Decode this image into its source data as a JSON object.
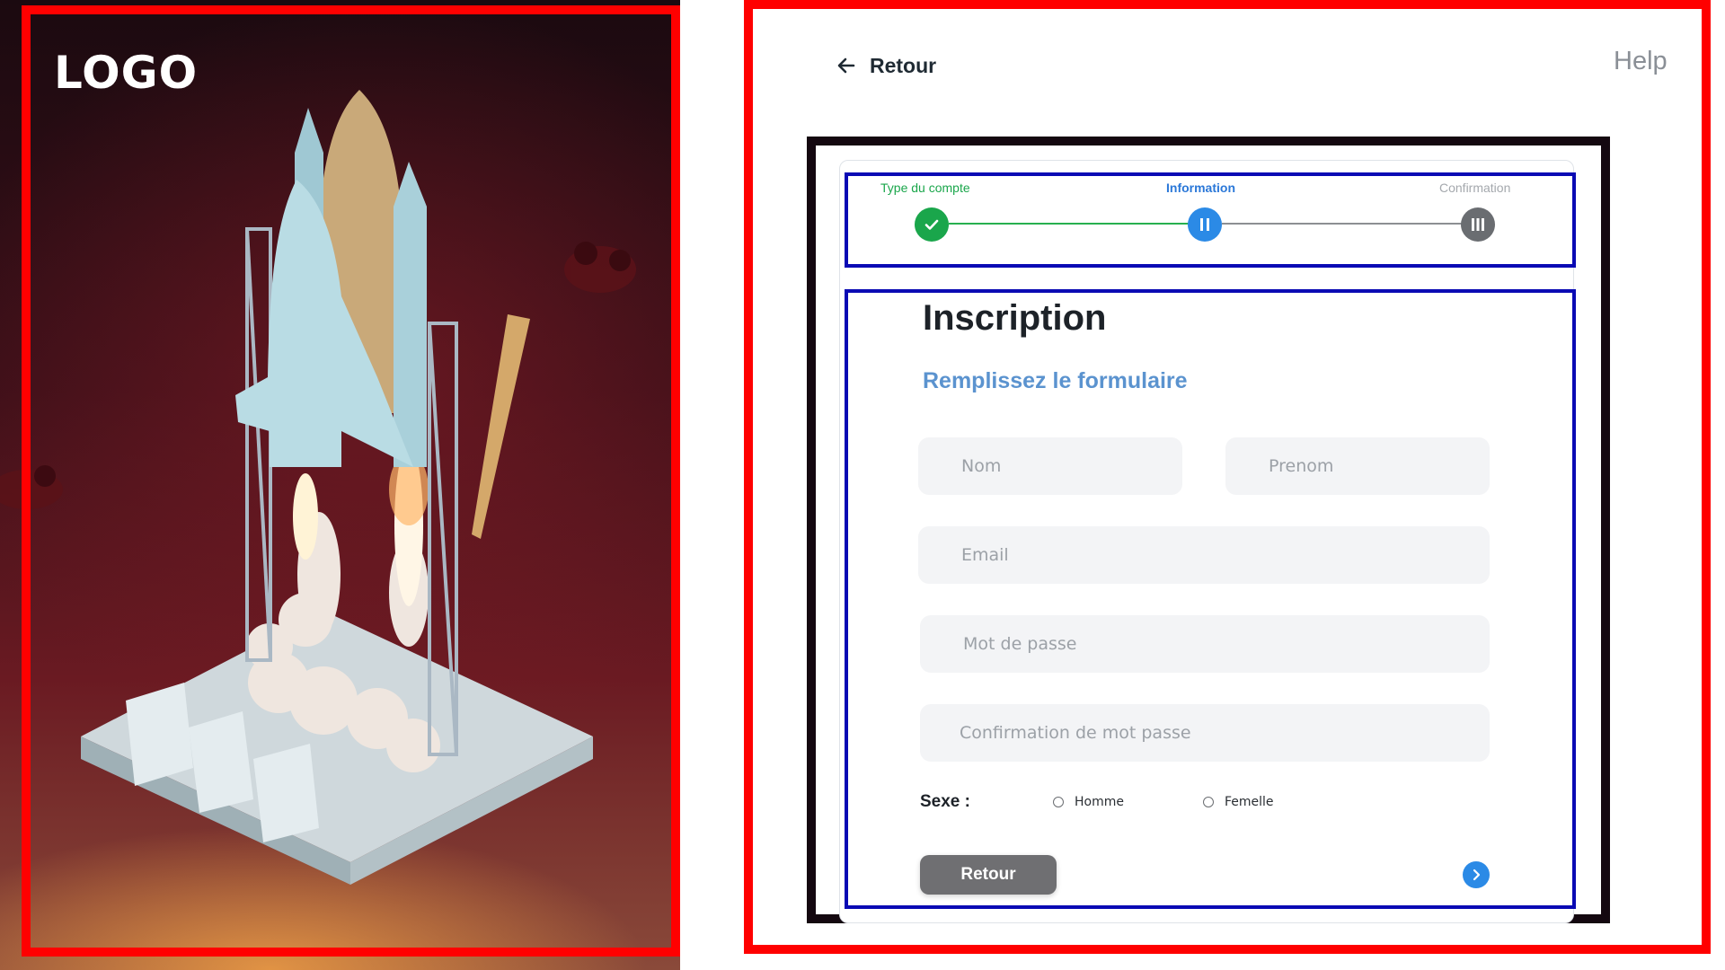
{
  "brand": {
    "logo_text": "LOGO"
  },
  "header": {
    "back_label": "Retour",
    "help_label": "Help"
  },
  "stepper": {
    "steps": [
      {
        "label": "Type du compte",
        "state": "done",
        "icon": "check-icon"
      },
      {
        "label": "Information",
        "state": "active",
        "icon": "pause-icon"
      },
      {
        "label": "Confirmation",
        "state": "pending",
        "icon": "bars-icon"
      }
    ]
  },
  "form": {
    "title": "Inscription",
    "subtitle": "Remplissez le formulaire",
    "fields": {
      "nom": {
        "placeholder": "Nom",
        "value": ""
      },
      "prenom": {
        "placeholder": "Prenom",
        "value": ""
      },
      "email": {
        "placeholder": "Email",
        "value": ""
      },
      "password": {
        "placeholder": "Mot de passe",
        "value": ""
      },
      "password_confirm": {
        "placeholder": "Confirmation de mot passe",
        "value": ""
      }
    },
    "sexe": {
      "label": "Sexe :",
      "options": [
        "Homme",
        "Femelle"
      ],
      "selected": null
    },
    "back_button": "Retour",
    "next_icon": "chevron-right-icon"
  },
  "colors": {
    "accent_blue": "#2b8ae6",
    "step_done_green": "#1aa64b",
    "subtitle_blue": "#5b93cf",
    "annotation_red": "#ff0000",
    "annotation_navy": "#0a0ab4"
  }
}
